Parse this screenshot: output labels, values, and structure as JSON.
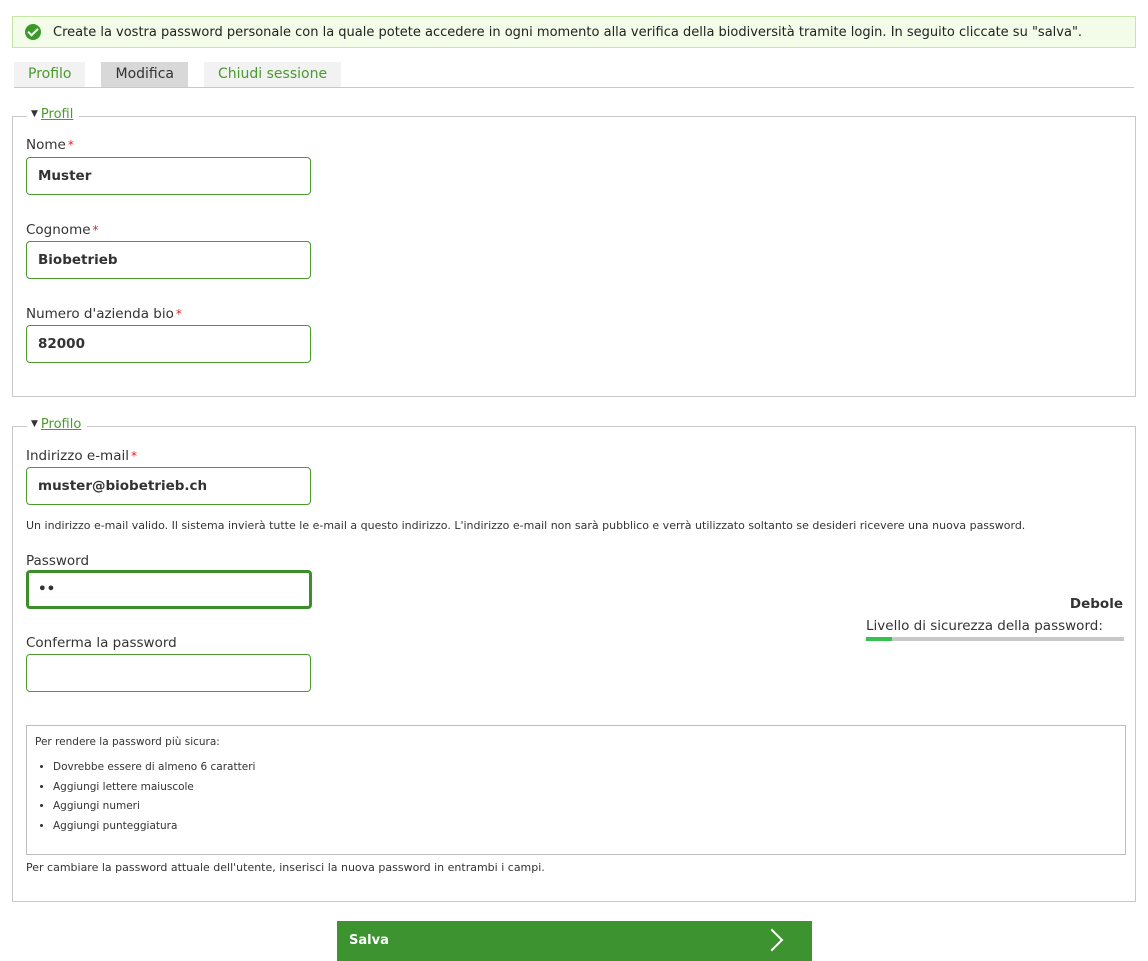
{
  "status": {
    "icon": "check-circle-icon",
    "message": "Create la vostra password personale con la quale potete accedere in ogni momento alla verifica della biodiversità tramite login. In seguito cliccate su \"salva\"."
  },
  "tabs": [
    {
      "label": "Profilo"
    },
    {
      "label": "Modifica",
      "active": true
    },
    {
      "label": "Chiudi sessione"
    }
  ],
  "section1": {
    "legend": "Profil",
    "fields": {
      "nome": {
        "label": "Nome",
        "value": "Muster"
      },
      "cognome": {
        "label": "Cognome",
        "value": "Biobetrieb"
      },
      "numero": {
        "label": "Numero d'azienda bio",
        "value": "82000"
      }
    }
  },
  "section2": {
    "legend": "Profilo",
    "email": {
      "label": "Indirizzo e-mail",
      "value": "muster@biobetrieb.ch",
      "help": "Un indirizzo e-mail valido. Il sistema invierà tutte le e-mail a questo indirizzo. L'indirizzo e-mail non sarà pubblico e verrà utilizzato soltanto se desideri ricevere una nuova password."
    },
    "password": {
      "label": "Password",
      "value": "••"
    },
    "confirm": {
      "label": "Conferma la password",
      "value": ""
    },
    "strength": {
      "word": "Debole",
      "title": "Livello di sicurezza della password:",
      "level_percent": 10,
      "color": "#34c24a"
    },
    "tips": {
      "title": "Per rendere la password più sicura:",
      "items": [
        "Dovrebbe essere di almeno 6 caratteri",
        "Aggiungi lettere maiuscole",
        "Aggiungi numeri",
        "Aggiungi punteggiatura"
      ]
    },
    "footer_help": "Per cambiare la password attuale dell'utente, inserisci la nuova password in entrambi i campi."
  },
  "save_button": {
    "label": "Salva",
    "icon": "chevron-right-icon"
  },
  "colors": {
    "accent": "#3c9330",
    "link": "#4a9a2e",
    "required": "#d8262b"
  }
}
